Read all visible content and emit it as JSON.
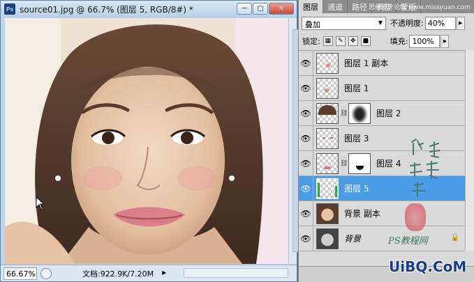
{
  "document": {
    "title": "source01.jpg @ 66.7% (图层 5, RGB/8#) *",
    "logo": "Ps",
    "window_buttons": [
      "─",
      "▢",
      "✕"
    ],
    "zoom": "66.67%",
    "doc_info": "文档:922.9K/7.20M"
  },
  "panel": {
    "tabs": [
      {
        "label": "图层",
        "active": true
      },
      {
        "label": "通道",
        "active": false
      },
      {
        "label": "路径",
        "active": false
      },
      {
        "label": "调整",
        "active": false
      },
      {
        "label": "蒙版",
        "active": false
      }
    ],
    "tab_watermark": "思缘设计论坛 www.missyuan.com",
    "blend_mode": "叠加",
    "opacity_label": "不透明度:",
    "opacity_value": "40%",
    "lock_label": "锁定:",
    "fill_label": "填充:",
    "fill_value": "100%",
    "layers": [
      {
        "name": "图层 1 副本",
        "visible": true,
        "selected": false,
        "has_mask": false,
        "thumb": "pink-dot"
      },
      {
        "name": "图层 1",
        "visible": true,
        "selected": false,
        "has_mask": false,
        "thumb": "pink-dot"
      },
      {
        "name": "图层 2",
        "visible": true,
        "selected": false,
        "has_mask": true,
        "thumb": "hair"
      },
      {
        "name": "图层 3",
        "visible": true,
        "selected": false,
        "has_mask": false,
        "thumb": "face-marks"
      },
      {
        "name": "图层 4",
        "visible": true,
        "selected": false,
        "has_mask": true,
        "thumb": "lips"
      },
      {
        "name": "图层 5",
        "visible": true,
        "selected": true,
        "has_mask": false,
        "thumb": "green"
      },
      {
        "name": "背景 副本",
        "visible": true,
        "selected": false,
        "has_mask": false,
        "thumb": "photo"
      },
      {
        "name": "背景",
        "visible": true,
        "selected": false,
        "has_mask": false,
        "thumb": "photo-gray",
        "locked": true
      }
    ]
  },
  "watermark": {
    "ps_text": "PS教程网",
    "url": "UiBQ.CoM"
  },
  "colors": {
    "selection": "#4a9ce8",
    "panel_bg": "#d9d9d9",
    "title_gradient": "#b9cfe7"
  }
}
